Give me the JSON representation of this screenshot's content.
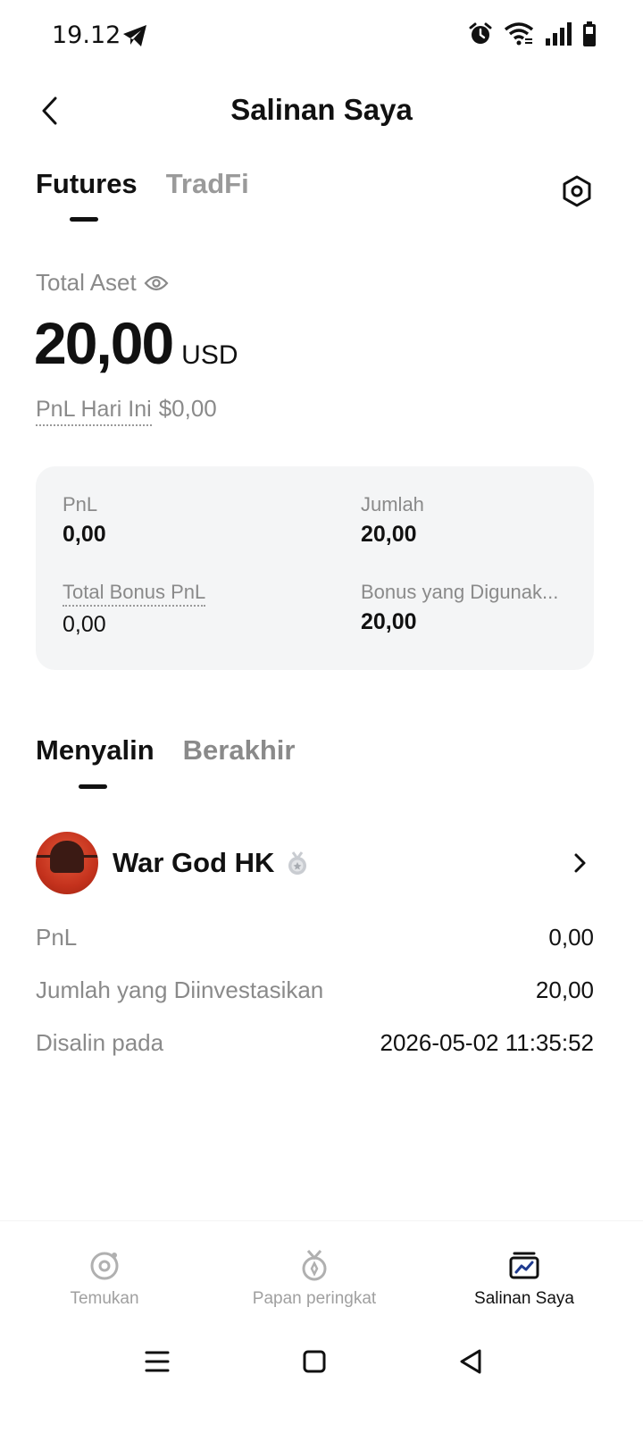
{
  "status_bar": {
    "time": "19.12",
    "icons": [
      "telegram-icon",
      "alarm-icon",
      "wifi-icon",
      "signal-icon",
      "battery-icon"
    ]
  },
  "header": {
    "title": "Salinan Saya",
    "back_icon": "chevron-left-icon"
  },
  "top_tabs": [
    {
      "label": "Futures",
      "active": true
    },
    {
      "label": "TradFi",
      "active": false
    }
  ],
  "settings_icon": "hex-settings-icon",
  "asset": {
    "label": "Total Aset",
    "value": "20,00",
    "unit": "USD",
    "pnl_today_label": "PnL Hari Ini",
    "pnl_today_value": "$0,00"
  },
  "stats": {
    "pnl_label": "PnL",
    "pnl_value": "0,00",
    "amount_label": "Jumlah",
    "amount_value": "20,00",
    "bonus_pnl_label": "Total Bonus PnL",
    "bonus_pnl_value": "0,00",
    "bonus_used_label": "Bonus yang Digunak...",
    "bonus_used_value": "20,00"
  },
  "copy_tabs": [
    {
      "label": "Menyalin",
      "active": true
    },
    {
      "label": "Berakhir",
      "active": false
    }
  ],
  "trader": {
    "name": "War God HK",
    "rows": [
      {
        "label": "PnL",
        "value": "0,00"
      },
      {
        "label": "Jumlah yang Diinvestasikan",
        "value": "20,00"
      },
      {
        "label": "Disalin pada",
        "value": "2026-05-02 11:35:52"
      }
    ]
  },
  "bottom_nav": [
    {
      "label": "Temukan",
      "icon": "discover-icon",
      "active": false
    },
    {
      "label": "Papan peringkat",
      "icon": "medal-icon",
      "active": false
    },
    {
      "label": "Salinan Saya",
      "icon": "copy-portfolio-icon",
      "active": true
    }
  ],
  "colors": {
    "text_primary": "#111111",
    "text_secondary": "#8a8a8a",
    "card_bg": "#f4f5f6",
    "nav_active_icon": "#1f3b8f"
  }
}
